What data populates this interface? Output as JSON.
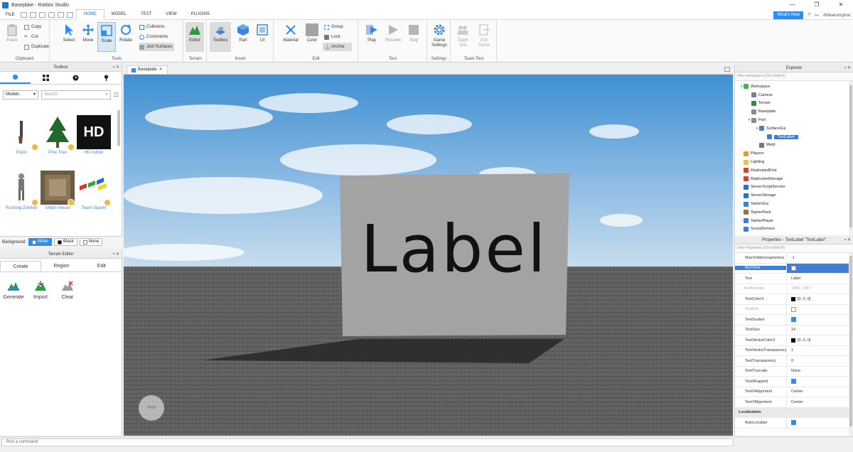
{
  "window": {
    "title": "Baseplate - Roblox Studio",
    "minimize": "—",
    "restore": "❐",
    "close": "✕"
  },
  "menubar": {
    "file": "FILE",
    "tabs": [
      {
        "label": "HOME"
      },
      {
        "label": "MODEL"
      },
      {
        "label": "TEST"
      },
      {
        "label": "VIEW"
      },
      {
        "label": "PLUGINS"
      }
    ],
    "active_tab": "HOME",
    "whats_new": "What's New",
    "username": "Athkanoriginal"
  },
  "ribbon": {
    "clipboard": {
      "label": "Clipboard",
      "paste": "Paste",
      "copy": "Copy",
      "cut": "Cut",
      "duplicate": "Duplicate"
    },
    "tools": {
      "label": "Tools",
      "select": "Select",
      "move": "Move",
      "scale": "Scale",
      "rotate": "Rotate",
      "collisions": "Collisions",
      "constraints": "Constraints",
      "join_surfaces": "Join Surfaces"
    },
    "terrain": {
      "label": "Terrain",
      "editor": "Editor"
    },
    "insert": {
      "label": "Insert",
      "toolbox": "Toolbox",
      "part": "Part",
      "ui": "UI"
    },
    "edit": {
      "label": "Edit",
      "material": "Material",
      "color": "Color",
      "group": "Group",
      "lock": "Lock",
      "anchor": "Anchor"
    },
    "test": {
      "label": "Test",
      "play": "Play",
      "resume": "Resume",
      "stop": "Stop"
    },
    "settings": {
      "label": "Settings",
      "game_settings": "Game Settings"
    },
    "team_test": {
      "label": "Team Test",
      "team_test": "Team Test",
      "exit_game": "Exit Game"
    }
  },
  "toolbox": {
    "title": "Toolbox",
    "category": "Models",
    "search_placeholder": "Search",
    "assets": [
      {
        "name": "Pistol"
      },
      {
        "name": "Pine Tree"
      },
      {
        "name": "HD Admin"
      },
      {
        "name": "Running Zombie"
      },
      {
        "name": "Urban House"
      },
      {
        "name": "Team Spawn"
      }
    ],
    "hd_text": "HD",
    "background_label": "Background:",
    "backgrounds": [
      "White",
      "Black",
      "None"
    ],
    "active_background": "White"
  },
  "terrain_editor": {
    "title": "Terrain Editor",
    "tabs": [
      "Create",
      "Region",
      "Edit"
    ],
    "active_tab": "Create",
    "tools": [
      {
        "label": "Generate"
      },
      {
        "label": "Import"
      },
      {
        "label": "Clear"
      }
    ]
  },
  "viewport": {
    "tab": "Baseplate",
    "label_text": "Label",
    "fwd_button": "Fwd",
    "colors": {
      "sky_top": "#3f8fd2",
      "sky_bottom": "#cfe0ee",
      "ground": "#595959",
      "part": "#a3a3a3"
    }
  },
  "explorer": {
    "title": "Explorer",
    "filter_placeholder": "Filter workspace (Ctrl+Shift+X)",
    "items": [
      {
        "label": "Workspace",
        "depth": 0,
        "twisty": "▾",
        "icon": "workspace-icon",
        "color": "#4caf50"
      },
      {
        "label": "Camera",
        "depth": 1,
        "twisty": "",
        "icon": "camera-icon",
        "color": "#6b7fa8"
      },
      {
        "label": "Terrain",
        "depth": 1,
        "twisty": "",
        "icon": "terrain-icon",
        "color": "#2e8b3a"
      },
      {
        "label": "Baseplate",
        "depth": 1,
        "twisty": "",
        "icon": "part-icon",
        "color": "#8a8a8a"
      },
      {
        "label": "Part",
        "depth": 1,
        "twisty": "▾",
        "icon": "part-icon",
        "color": "#8a8a8a"
      },
      {
        "label": "SurfaceGui",
        "depth": 2,
        "twisty": "▾",
        "icon": "surfacegui-icon",
        "color": "#4f81bd"
      },
      {
        "label": "TextLabel",
        "depth": 3,
        "twisty": "",
        "icon": "textlabel-icon",
        "color": "#3d7fd6",
        "selected": true
      },
      {
        "label": "Weld",
        "depth": 2,
        "twisty": "",
        "icon": "weld-icon",
        "color": "#777"
      },
      {
        "label": "Players",
        "depth": 0,
        "twisty": "",
        "icon": "players-icon",
        "color": "#e0a030"
      },
      {
        "label": "Lighting",
        "depth": 0,
        "twisty": "",
        "icon": "lighting-icon",
        "color": "#f0c040"
      },
      {
        "label": "ReplicatedFirst",
        "depth": 0,
        "twisty": "",
        "icon": "replicated-first-icon",
        "color": "#d04040"
      },
      {
        "label": "ReplicatedStorage",
        "depth": 0,
        "twisty": "",
        "icon": "replicated-storage-icon",
        "color": "#d04040"
      },
      {
        "label": "ServerScriptService",
        "depth": 0,
        "twisty": "",
        "icon": "server-script-service-icon",
        "color": "#3070c0"
      },
      {
        "label": "ServerStorage",
        "depth": 0,
        "twisty": "",
        "icon": "server-storage-icon",
        "color": "#3070c0"
      },
      {
        "label": "StarterGui",
        "depth": 0,
        "twisty": "",
        "icon": "starter-gui-icon",
        "color": "#3d7fd6"
      },
      {
        "label": "StarterPack",
        "depth": 0,
        "twisty": "",
        "icon": "starter-pack-icon",
        "color": "#a07040"
      },
      {
        "label": "StarterPlayer",
        "depth": 0,
        "twisty": "›",
        "icon": "starter-player-icon",
        "color": "#3d7fd6"
      },
      {
        "label": "SoundService",
        "depth": 0,
        "twisty": "",
        "icon": "sound-service-icon",
        "color": "#3d7fd6"
      }
    ]
  },
  "properties": {
    "title": "Properties - TextLabel \"TextLabel\"",
    "filter_placeholder": "Filter Properties (Ctrl+Shift+P)",
    "rows": [
      {
        "name": "MaxVisibleGraphemes",
        "value": "-1",
        "kind": "text",
        "dim": false
      },
      {
        "name": "RichText",
        "value": "",
        "kind": "check",
        "checked": false,
        "highlight": true
      },
      {
        "name": "Text",
        "value": "Label",
        "kind": "text"
      },
      {
        "name": "TextBounds",
        "value": "1085, 1087",
        "kind": "text",
        "dim": true,
        "expand": "›"
      },
      {
        "name": "TextColor3",
        "value": "[0, 0, 0]",
        "kind": "color",
        "color": "#000000"
      },
      {
        "name": "TextFits",
        "value": "",
        "kind": "check",
        "checked": false,
        "dim": true
      },
      {
        "name": "TextScaled",
        "value": "",
        "kind": "check",
        "checked": true
      },
      {
        "name": "TextSize",
        "value": "14",
        "kind": "text"
      },
      {
        "name": "TextStrokeColor3",
        "value": "[0, 0, 0]",
        "kind": "color",
        "color": "#000000"
      },
      {
        "name": "TextStrokeTransparency",
        "value": "1",
        "kind": "text"
      },
      {
        "name": "TextTransparency",
        "value": "0",
        "kind": "text"
      },
      {
        "name": "TextTruncate",
        "value": "None",
        "kind": "text"
      },
      {
        "name": "TextWrapped",
        "value": "",
        "kind": "check",
        "checked": true
      },
      {
        "name": "TextXAlignment",
        "value": "Center",
        "kind": "text"
      },
      {
        "name": "TextYAlignment",
        "value": "Center",
        "kind": "text"
      },
      {
        "name": "Localization",
        "value": "",
        "kind": "category"
      },
      {
        "name": "AutoLocalize",
        "value": "",
        "kind": "check",
        "checked": true
      }
    ]
  },
  "statusbar": {
    "command_placeholder": "Run a command"
  },
  "colors": {
    "accent": "#2f8cf0",
    "selection": "#3d7fd6"
  }
}
